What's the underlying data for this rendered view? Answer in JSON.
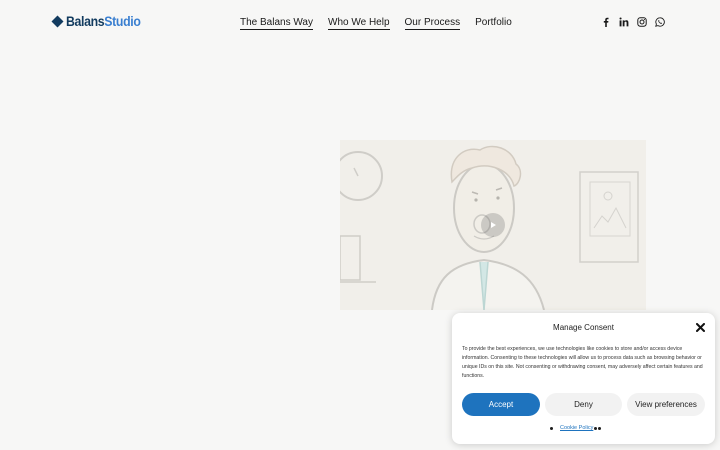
{
  "header": {
    "logo": {
      "part1": "Balans",
      "part2": "Studio"
    },
    "nav": [
      {
        "label": "The Balans Way"
      },
      {
        "label": "Who We Help"
      },
      {
        "label": "Our Process"
      },
      {
        "label": "Portfolio"
      }
    ],
    "social_icons": [
      "facebook-icon",
      "linkedin-icon",
      "instagram-icon",
      "whatsapp-icon"
    ]
  },
  "video": {
    "icon": "play-icon"
  },
  "consent": {
    "title": "Manage Consent",
    "body": "To provide the best experiences, we use technologies like cookies to store and/or access device information. Consenting to these technologies will allow us to process data such as browsing behavior or unique IDs on this site. Not consenting or withdrawing consent, may adversely affect certain features and functions.",
    "accept_label": "Accept",
    "deny_label": "Deny",
    "preferences_label": "View preferences",
    "cookie_policy_label": "Cookie Policy"
  },
  "colors": {
    "accent": "#1e73be",
    "logo_dark": "#123b5f",
    "logo_light": "#3a7fd0",
    "background": "#f7f7f6"
  }
}
